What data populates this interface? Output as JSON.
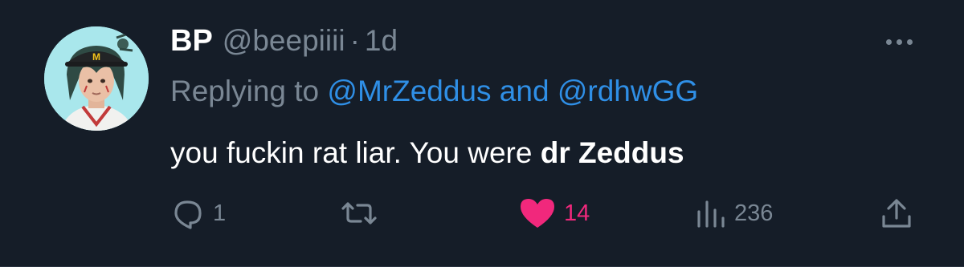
{
  "author": {
    "display_name": "BP",
    "handle": "@beepiiii",
    "separator": "·",
    "time": "1d"
  },
  "reply": {
    "prefix": "Replying to",
    "mention1": "@MrZeddus",
    "conjunction": "and",
    "mention2": "@rdhwGG"
  },
  "text": {
    "plain": "you fuckin rat liar. You were ",
    "bold": "dr Zeddus"
  },
  "actions": {
    "reply": {
      "icon": "reply-icon",
      "count": "1"
    },
    "retweet": {
      "icon": "retweet-icon",
      "count": ""
    },
    "like": {
      "icon": "heart-icon",
      "count": "14",
      "liked": true
    },
    "views": {
      "icon": "views-icon",
      "count": "236"
    },
    "share": {
      "icon": "share-icon"
    }
  },
  "colors": {
    "background": "#151d28",
    "muted": "#7a8794",
    "link": "#2f8fe6",
    "like": "#f1287c",
    "avatar_bg": "#a9e7ec"
  }
}
